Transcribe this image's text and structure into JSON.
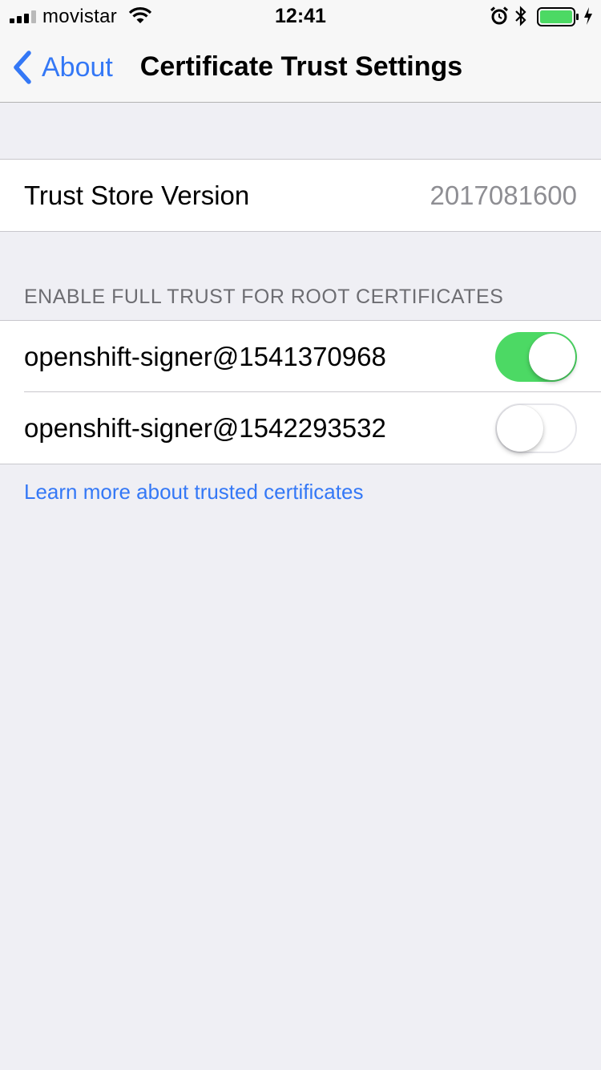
{
  "status_bar": {
    "carrier": "movistar",
    "time": "12:41"
  },
  "nav": {
    "back_label": "About",
    "title": "Certificate Trust Settings"
  },
  "trust_store": {
    "label": "Trust Store Version",
    "value": "2017081600"
  },
  "certificates": {
    "header": "ENABLE FULL TRUST FOR ROOT CERTIFICATES",
    "items": [
      {
        "name": "openshift-signer@1541370968",
        "enabled": true
      },
      {
        "name": "openshift-signer@1542293532",
        "enabled": false
      }
    ],
    "footer_link": "Learn more about trusted certificates"
  },
  "colors": {
    "accent": "#3478f6",
    "toggle_on": "#4cd964",
    "background": "#efeff4"
  }
}
